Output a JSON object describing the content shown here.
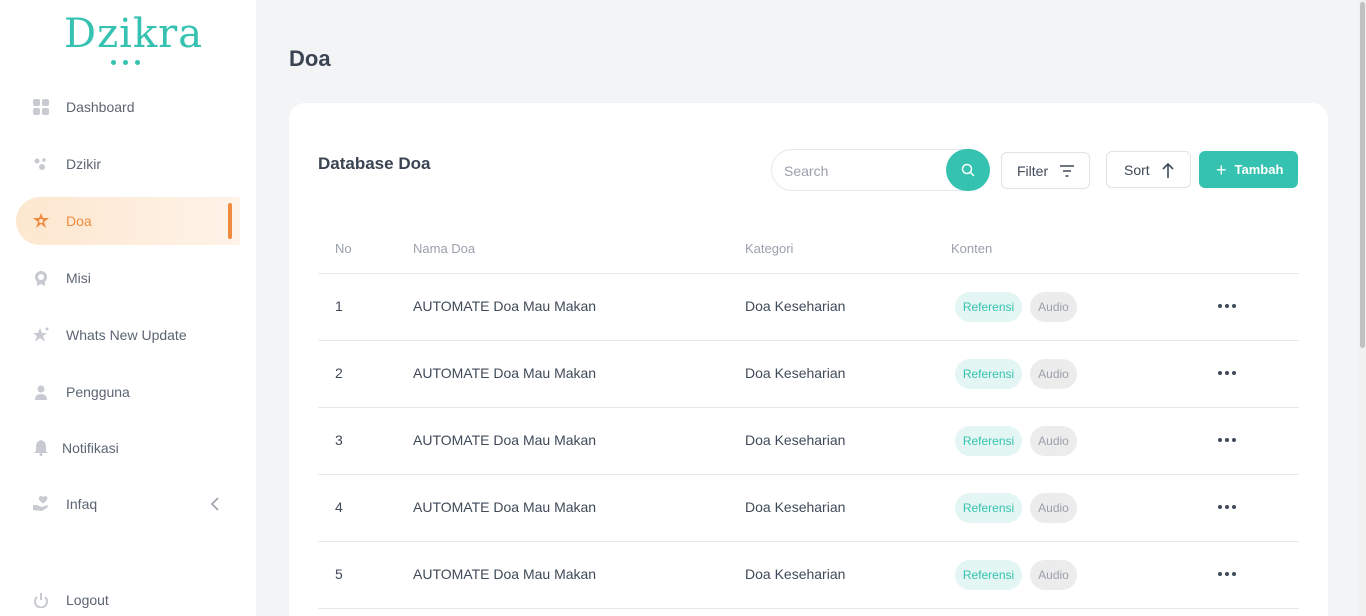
{
  "sidebar": {
    "logo": "Dzikra",
    "items": [
      {
        "label": "Dashboard",
        "icon": "dashboard-icon"
      },
      {
        "label": "Dzikir",
        "icon": "dzikir-icon"
      },
      {
        "label": "Doa",
        "icon": "star-icon",
        "active": true
      },
      {
        "label": "Misi",
        "icon": "medal-icon"
      },
      {
        "label": "Whats New Update",
        "icon": "sparkle-star-icon"
      },
      {
        "label": "Pengguna",
        "icon": "user-icon"
      },
      {
        "label": "Notifikasi",
        "icon": "bell-icon"
      },
      {
        "label": "Infaq",
        "icon": "hand-heart-icon"
      }
    ],
    "logout": "Logout"
  },
  "page": {
    "title": "Doa"
  },
  "card": {
    "title": "Database Doa",
    "search_placeholder": "Search",
    "filter_label": "Filter",
    "sort_label": "Sort",
    "add_label": "Tambah"
  },
  "table": {
    "headers": {
      "no": "No",
      "nama": "Nama Doa",
      "kategori": "Kategori",
      "konten": "Konten"
    },
    "rows": [
      {
        "no": "1",
        "nama": "AUTOMATE Doa Mau Makan",
        "kategori": "Doa Keseharian",
        "badge1": "Referensi",
        "badge2": "Audio"
      },
      {
        "no": "2",
        "nama": "AUTOMATE Doa Mau Makan",
        "kategori": "Doa Keseharian",
        "badge1": "Referensi",
        "badge2": "Audio"
      },
      {
        "no": "3",
        "nama": "AUTOMATE Doa Mau Makan",
        "kategori": "Doa Keseharian",
        "badge1": "Referensi",
        "badge2": "Audio"
      },
      {
        "no": "4",
        "nama": "AUTOMATE Doa Mau Makan",
        "kategori": "Doa Keseharian",
        "badge1": "Referensi",
        "badge2": "Audio"
      },
      {
        "no": "5",
        "nama": "AUTOMATE Doa Mau Makan",
        "kategori": "Doa Keseharian",
        "badge1": "Referensi",
        "badge2": "Audio"
      }
    ]
  },
  "colors": {
    "accent": "#35c2b0",
    "active": "#f08a3e"
  }
}
